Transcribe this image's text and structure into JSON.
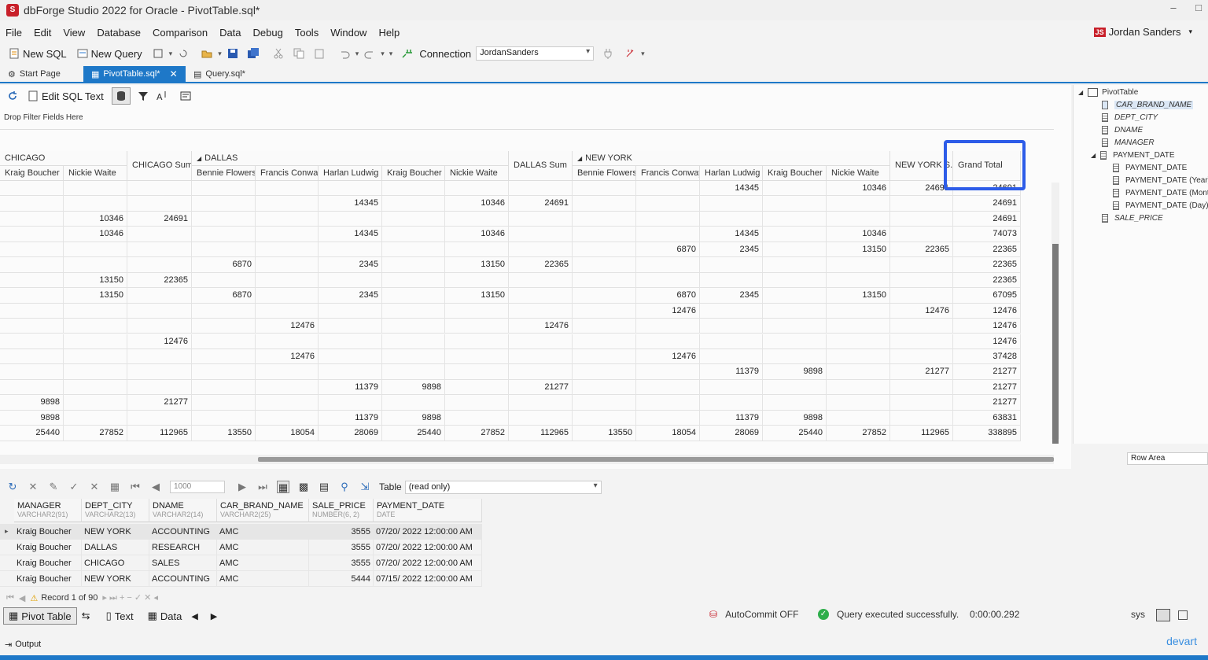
{
  "window": {
    "title": "dbForge Studio 2022 for Oracle - PivotTable.sql*",
    "app_icon": "S"
  },
  "menu": [
    "File",
    "Edit",
    "View",
    "Database",
    "Comparison",
    "Data",
    "Debug",
    "Tools",
    "Window",
    "Help"
  ],
  "user": {
    "badge": "JS",
    "name": "Jordan Sanders"
  },
  "toolbar": {
    "new_sql": "New SQL",
    "new_query": "New Query",
    "connection_label": "Connection",
    "connection_value": "JordanSanders"
  },
  "doc_tabs": {
    "start": "Start Page",
    "pivot": "PivotTable.sql*",
    "query": "Query.sql*"
  },
  "pivot_toolbar": {
    "edit_sql": "Edit SQL Text",
    "drop_filter": "Drop Filter Fields Here"
  },
  "pivot": {
    "groups": {
      "chicago": "CHICAGO",
      "chicago_sum": "CHICAGO Sum",
      "dallas": "DALLAS",
      "dallas_sum": "DALLAS Sum",
      "newyork": "NEW YORK",
      "newyork_sum": "NEW YORK S...",
      "grand_total": "Grand Total"
    },
    "names": [
      "Kraig Boucher",
      "Nickie Waite",
      "Bennie Flowers",
      "Francis Conway",
      "Harlan Ludwig",
      "Kraig Boucher",
      "Nickie Waite",
      "Bennie Flowers",
      "Francis Conway",
      "Harlan Ludwig",
      "Kraig Boucher",
      "Nickie Waite"
    ],
    "rows": [
      [
        "",
        "",
        "",
        "",
        "",
        "",
        "",
        "",
        "",
        "",
        "",
        "14345",
        "",
        "10346",
        "24691",
        "24691"
      ],
      [
        "",
        "",
        "",
        "",
        "",
        "14345",
        "",
        "10346",
        "24691",
        "",
        "",
        "",
        "",
        "",
        "",
        "24691"
      ],
      [
        "",
        "10346",
        "24691",
        "",
        "",
        "",
        "",
        "",
        "",
        "",
        "",
        "",
        "",
        "",
        "",
        "24691"
      ],
      [
        "",
        "10346",
        "",
        "",
        "",
        "14345",
        "",
        "10346",
        "",
        "",
        "",
        "14345",
        "",
        "10346",
        "",
        "74073"
      ],
      [
        "",
        "",
        "",
        "",
        "",
        "",
        "",
        "",
        "",
        "",
        "6870",
        "2345",
        "",
        "13150",
        "22365",
        "22365"
      ],
      [
        "",
        "",
        "",
        "6870",
        "",
        "2345",
        "",
        "13150",
        "22365",
        "",
        "",
        "",
        "",
        "",
        "",
        "22365"
      ],
      [
        "",
        "13150",
        "22365",
        "",
        "",
        "",
        "",
        "",
        "",
        "",
        "",
        "",
        "",
        "",
        "",
        "22365"
      ],
      [
        "",
        "13150",
        "",
        "6870",
        "",
        "2345",
        "",
        "13150",
        "",
        "",
        "6870",
        "2345",
        "",
        "13150",
        "",
        "67095"
      ],
      [
        "",
        "",
        "",
        "",
        "",
        "",
        "",
        "",
        "",
        "",
        "12476",
        "",
        "",
        "",
        "12476",
        "12476"
      ],
      [
        "",
        "",
        "",
        "",
        "12476",
        "",
        "",
        "",
        "12476",
        "",
        "",
        "",
        "",
        "",
        "",
        "12476"
      ],
      [
        "",
        "",
        "12476",
        "",
        "",
        "",
        "",
        "",
        "",
        "",
        "",
        "",
        "",
        "",
        "",
        "12476"
      ],
      [
        "",
        "",
        "",
        "",
        "12476",
        "",
        "",
        "",
        "",
        "",
        "12476",
        "",
        "",
        "",
        "",
        "37428"
      ],
      [
        "",
        "",
        "",
        "",
        "",
        "",
        "",
        "",
        "",
        "",
        "",
        "11379",
        "9898",
        "",
        "21277",
        "21277"
      ],
      [
        "",
        "",
        "",
        "",
        "",
        "11379",
        "9898",
        "",
        "21277",
        "",
        "",
        "",
        "",
        "",
        "",
        "21277"
      ],
      [
        "9898",
        "",
        "21277",
        "",
        "",
        "",
        "",
        "",
        "",
        "",
        "",
        "",
        "",
        "",
        "",
        "21277"
      ],
      [
        "9898",
        "",
        "",
        "",
        "",
        "11379",
        "9898",
        "",
        "",
        "",
        "",
        "11379",
        "9898",
        "",
        "",
        "63831"
      ],
      [
        "25440",
        "27852",
        "112965",
        "13550",
        "18054",
        "28069",
        "25440",
        "27852",
        "112965",
        "13550",
        "18054",
        "28069",
        "25440",
        "27852",
        "112965",
        "338895"
      ]
    ]
  },
  "field_list": {
    "root": "PivotTable",
    "items": [
      "CAR_BRAND_NAME",
      "DEPT_CITY",
      "DNAME",
      "MANAGER",
      "PAYMENT_DATE",
      "PAYMENT_DATE",
      "PAYMENT_DATE (Year)",
      "PAYMENT_DATE (Month)",
      "PAYMENT_DATE (Day)",
      "SALE_PRICE"
    ],
    "row_area": "Row Area"
  },
  "data_toolbar": {
    "page_size": "1000",
    "table_label": "Table",
    "table_value": "(read only)"
  },
  "data_grid": {
    "columns": [
      {
        "name": "MANAGER",
        "type": "VARCHAR2(91)"
      },
      {
        "name": "DEPT_CITY",
        "type": "VARCHAR2(13)"
      },
      {
        "name": "DNAME",
        "type": "VARCHAR2(14)"
      },
      {
        "name": "CAR_BRAND_NAME",
        "type": "VARCHAR2(25)"
      },
      {
        "name": "SALE_PRICE",
        "type": "NUMBER(6, 2)"
      },
      {
        "name": "PAYMENT_DATE",
        "type": "DATE"
      }
    ],
    "rows": [
      [
        "Kraig Boucher",
        "NEW YORK",
        "ACCOUNTING",
        "AMC",
        "3555",
        "07/20/ 2022 12:00:00 AM"
      ],
      [
        "Kraig Boucher",
        "DALLAS",
        "RESEARCH",
        "AMC",
        "3555",
        "07/20/ 2022 12:00:00 AM"
      ],
      [
        "Kraig Boucher",
        "CHICAGO",
        "SALES",
        "AMC",
        "3555",
        "07/20/ 2022 12:00:00 AM"
      ],
      [
        "Kraig Boucher",
        "NEW YORK",
        "ACCOUNTING",
        "AMC",
        "5444",
        "07/15/ 2022 12:00:00 AM"
      ]
    ],
    "record_text": "Record 1 of 90"
  },
  "bottom": {
    "pivot_table": "Pivot Table",
    "text": "Text",
    "data": "Data",
    "autocommit": "AutoCommit OFF",
    "status": "Query executed successfully.",
    "elapsed": "0:00:00.292",
    "user_short": "sys",
    "output": "Output",
    "brand": "devart"
  },
  "colors": {
    "accent": "#1e78c8",
    "highlight_box": "#2d5ce8",
    "ok": "#2eae4b",
    "brand_red": "#c8202a"
  }
}
